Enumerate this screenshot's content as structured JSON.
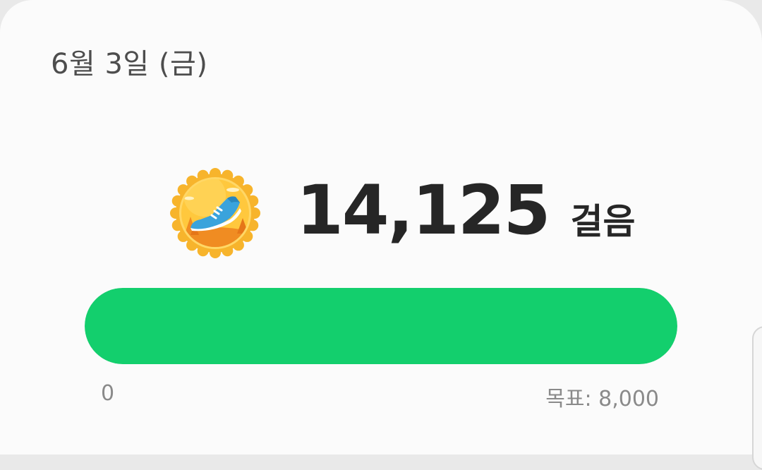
{
  "header": {
    "date": "6월 3일 (금)"
  },
  "steps": {
    "count": "14,125",
    "unit": "걸음",
    "badge_icon": "running-shoe-badge-icon"
  },
  "progress": {
    "min_label": "0",
    "goal_label": "목표: 8,000",
    "fraction": 1.0,
    "fill_color": "#13cf6d"
  }
}
